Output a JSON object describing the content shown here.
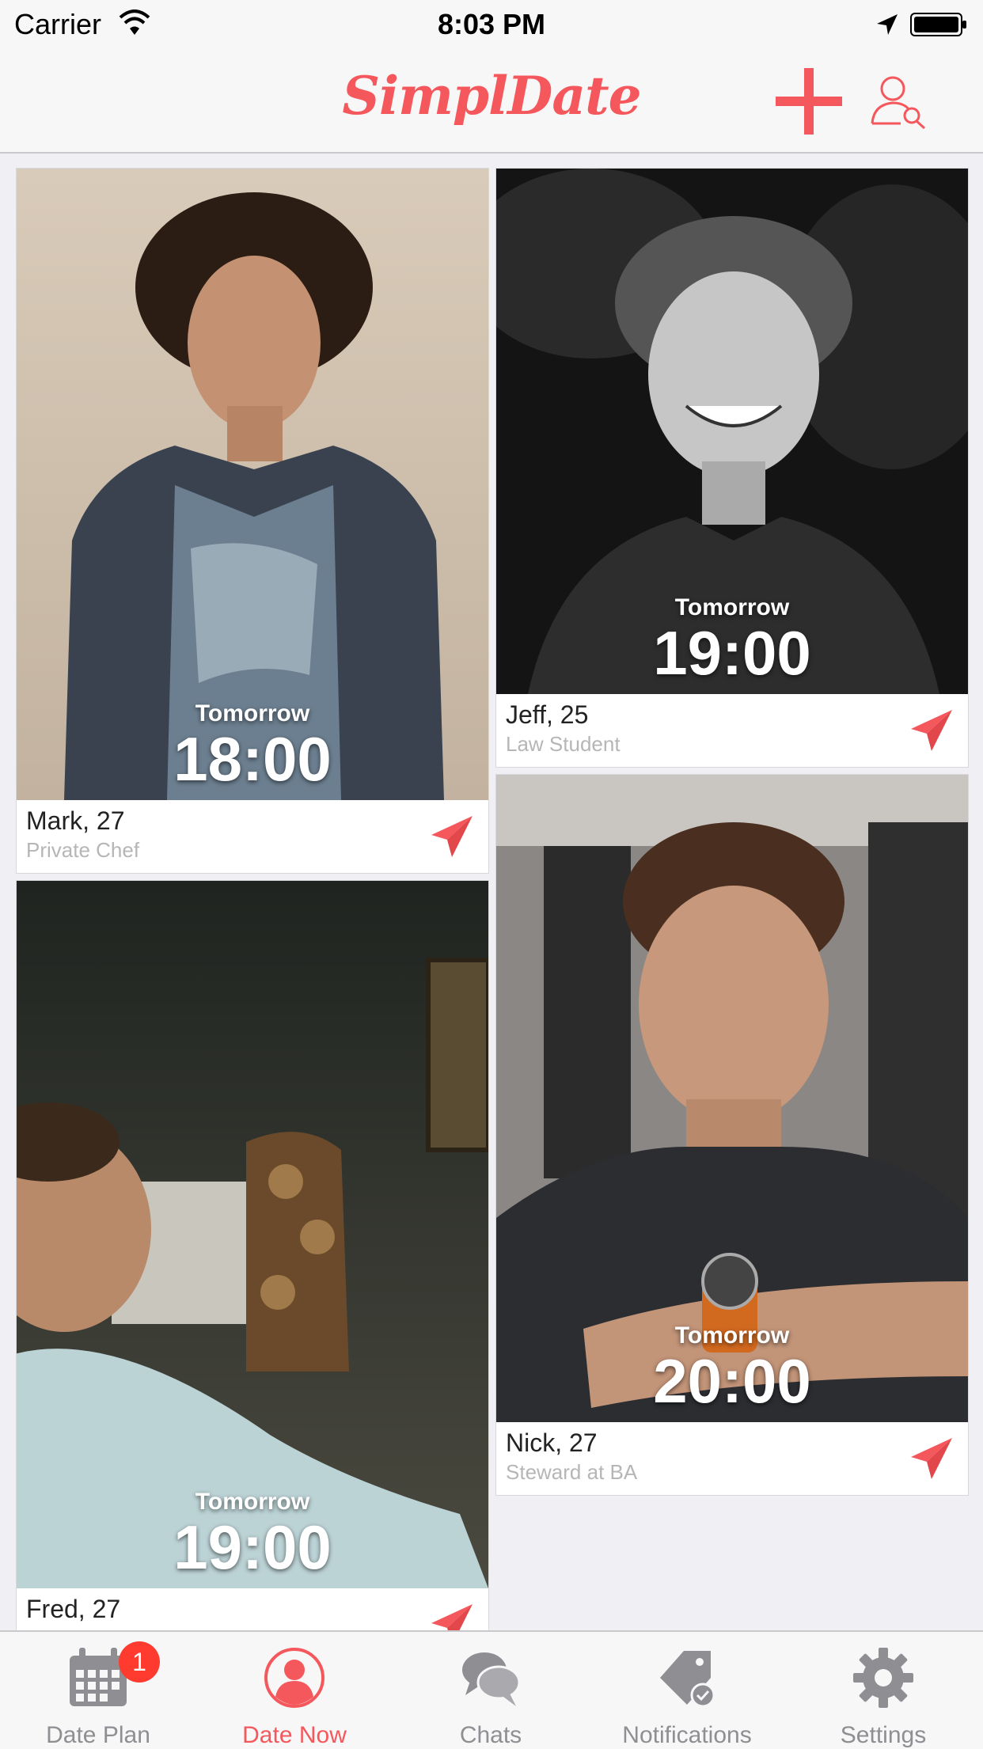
{
  "status_bar": {
    "carrier": "Carrier",
    "time": "8:03 PM"
  },
  "nav": {
    "title": "SimplDate"
  },
  "cards": [
    {
      "name": "Mark, 27",
      "job": "Private Chef",
      "day": "Tomorrow",
      "time": "18:00"
    },
    {
      "name": "Jeff, 25",
      "job": "Law Student",
      "day": "Tomorrow",
      "time": "19:00"
    },
    {
      "name": "Fred, 27",
      "job": "",
      "day": "Tomorrow",
      "time": "19:00"
    },
    {
      "name": "Nick, 27",
      "job": "Steward at BA",
      "day": "Tomorrow",
      "time": "20:00"
    }
  ],
  "tabs": [
    {
      "label": "Date Plan",
      "icon": "calendar-icon",
      "badge": "1"
    },
    {
      "label": "Date Now",
      "icon": "person-icon",
      "active": true
    },
    {
      "label": "Chats",
      "icon": "chat-bubbles-icon"
    },
    {
      "label": "Notifications",
      "icon": "tag-check-icon"
    },
    {
      "label": "Settings",
      "icon": "gear-icon"
    }
  ],
  "colors": {
    "accent": "#f5585c",
    "badge": "#ff3b30",
    "inactive": "#8e8e93"
  }
}
